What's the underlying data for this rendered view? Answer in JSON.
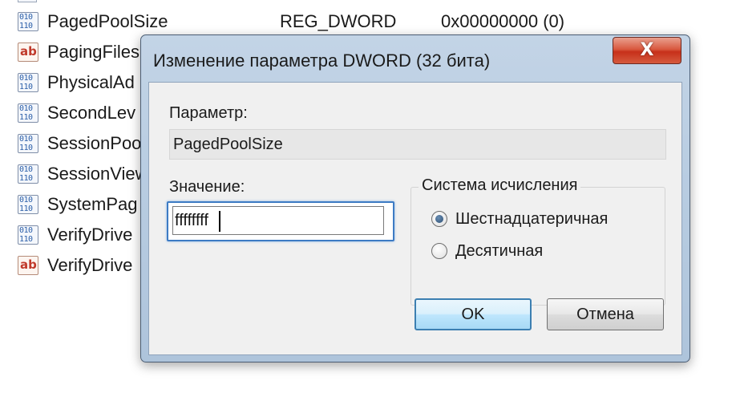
{
  "registry": {
    "rows": [
      {
        "icon": "binary-value-icon",
        "name": "PagedPoolSize",
        "type": "REG_DWORD",
        "data": "0x00000000 (0)"
      },
      {
        "icon": "string-value-icon",
        "name": "PagingFiles",
        "type": "",
        "data": ""
      },
      {
        "icon": "binary-value-icon",
        "name": "PhysicalAd",
        "type": "",
        "data": ""
      },
      {
        "icon": "binary-value-icon",
        "name": "SecondLev",
        "type": "",
        "data": ""
      },
      {
        "icon": "binary-value-icon",
        "name": "SessionPoo",
        "type": "",
        "data": ""
      },
      {
        "icon": "binary-value-icon",
        "name": "SessionView",
        "type": "",
        "data": ""
      },
      {
        "icon": "binary-value-icon",
        "name": "SystemPag",
        "type": "",
        "data": ""
      },
      {
        "icon": "binary-value-icon",
        "name": "VerifyDrive",
        "type": "",
        "data": ""
      },
      {
        "icon": "string-value-icon",
        "name": "VerifyDrive",
        "type": "",
        "data": ""
      }
    ]
  },
  "dialog": {
    "title": "Изменение параметра DWORD (32 бита)",
    "close_icon": "close-icon",
    "close_glyph": "X",
    "param_label": "Параметр:",
    "param_value": "PagedPoolSize",
    "value_label": "Значение:",
    "value_input": "ffffffff",
    "base_group_label": "Система исчисления",
    "base_options": [
      {
        "label": "Шестнадцатеричная",
        "checked": true
      },
      {
        "label": "Десятичная",
        "checked": false
      }
    ],
    "ok_label": "OK",
    "cancel_label": "Отмена"
  },
  "colors": {
    "title_bar": "#b9cde2",
    "close_button": "#c7301a",
    "focus_border": "#3d7bc4",
    "default_button": "#bee6fd"
  }
}
